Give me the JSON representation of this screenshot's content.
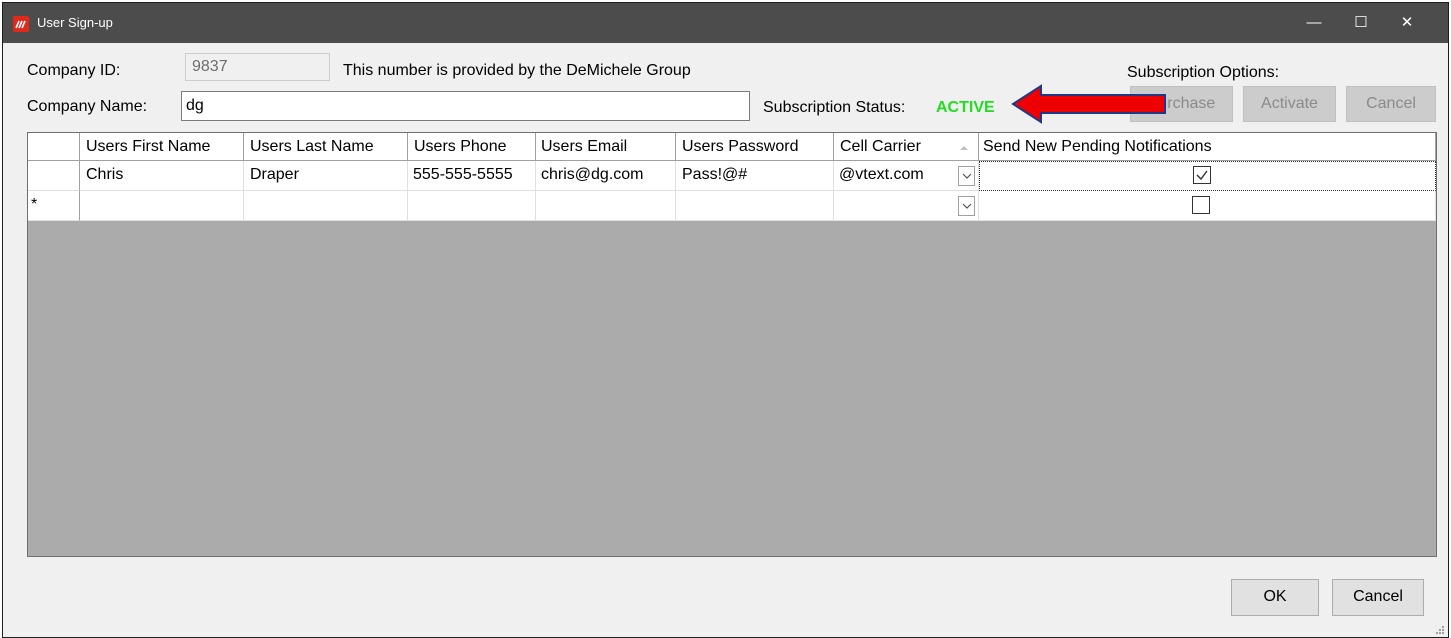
{
  "window": {
    "title": "User Sign-up",
    "minimize_glyph": "—",
    "maximize_glyph": "☐",
    "close_glyph": "✕"
  },
  "form": {
    "company_id_label": "Company ID:",
    "company_id_value": "9837",
    "company_id_note": "This number is provided by the DeMichele Group",
    "company_name_label": "Company Name:",
    "company_name_value": "dg",
    "subscription_status_label": "Subscription Status:",
    "subscription_status_value": "ACTIVE",
    "subscription_options_label": "Subscription Options:",
    "status_color": "#22dd22",
    "arrow_color": "#ee0000"
  },
  "subscription_buttons": {
    "purchase": "Purchase",
    "activate": "Activate",
    "cancel": "Cancel"
  },
  "grid": {
    "columns": [
      "Users First Name",
      "Users Last Name",
      "Users Phone",
      "Users Email",
      "Users Password",
      "Cell Carrier",
      "Send New Pending Notifications"
    ],
    "rows": [
      {
        "first": "Chris",
        "last": "Draper",
        "phone": "555-555-5555",
        "email": "chris@dg.com",
        "password": "Pass!@#",
        "carrier": "@vtext.com",
        "notify": true
      }
    ],
    "new_row_marker": "*"
  },
  "dialog_buttons": {
    "ok": "OK",
    "cancel": "Cancel"
  },
  "icons": [
    "app-icon",
    "minimize-icon",
    "maximize-icon",
    "close-icon",
    "sort-arrow-icon",
    "chevron-down-icon",
    "checkmark-icon",
    "resize-grip-icon",
    "red-arrow-icon"
  ]
}
